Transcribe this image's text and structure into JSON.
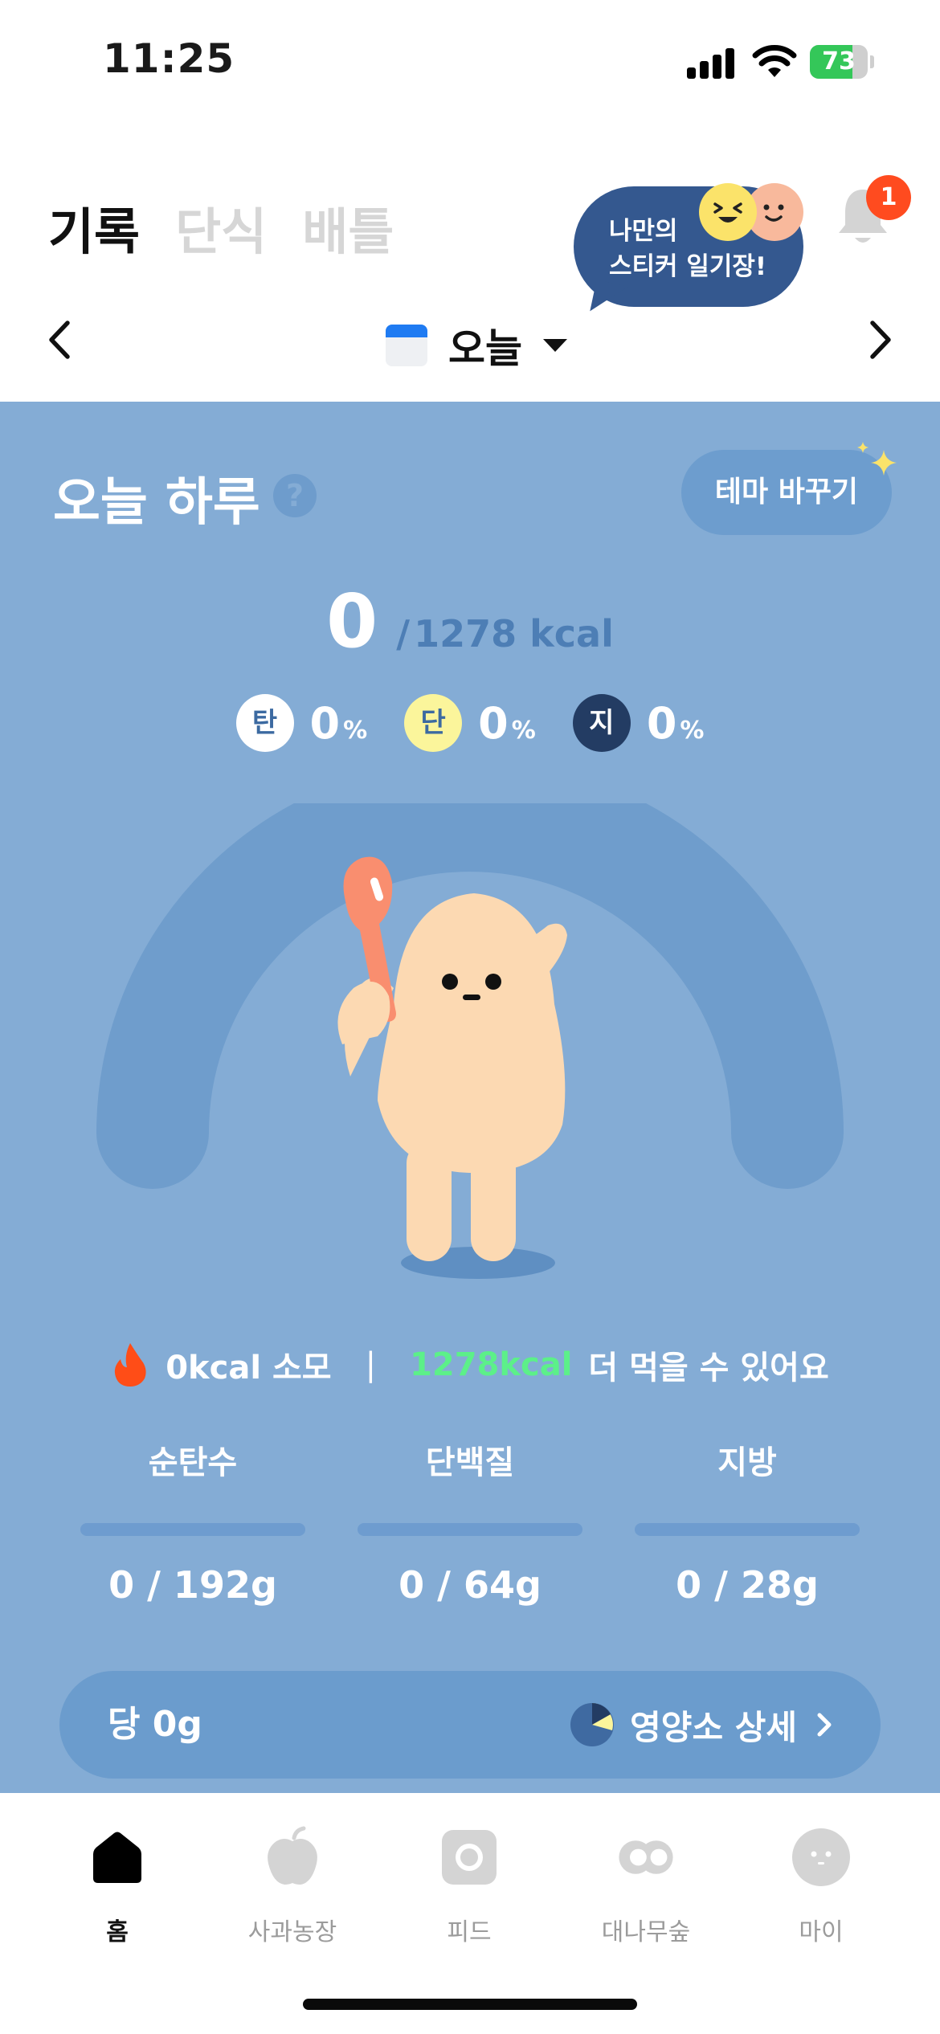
{
  "status_bar": {
    "time": "11:25",
    "battery": "73",
    "battery_level": 0.73,
    "icons": [
      "signal-icon",
      "wifi-icon",
      "battery-charging-icon"
    ]
  },
  "header": {
    "tabs": [
      {
        "label": "기록",
        "active": true
      },
      {
        "label": "단식",
        "active": false
      },
      {
        "label": "배틀",
        "active": false
      }
    ],
    "sticker_promo": {
      "line1": "나만의",
      "line2": "스티커 일기장!"
    },
    "notification_badge": "1",
    "date_label": "오늘"
  },
  "summary": {
    "title": "오늘 하루",
    "help": "?",
    "theme_button": "테마 바꾸기",
    "kcal_current": "0",
    "kcal_separator": "/",
    "kcal_target": "1278 kcal",
    "macros": [
      {
        "chip": "탄",
        "value": "0",
        "unit": "%"
      },
      {
        "chip": "단",
        "value": "0",
        "unit": "%"
      },
      {
        "chip": "지",
        "value": "0",
        "unit": "%"
      }
    ],
    "burn": {
      "burned": "0kcal 소모",
      "divider": "|",
      "remaining": "1278kcal",
      "remaining_suffix": "더 먹을 수 있어요"
    },
    "nutrients": [
      {
        "name": "순탄수",
        "value": "0 / 192g",
        "progress": 0
      },
      {
        "name": "단백질",
        "value": "0 / 64g",
        "progress": 0
      },
      {
        "name": "지방",
        "value": "0 / 28g",
        "progress": 0
      }
    ],
    "sugar": "당 0g",
    "detail_link": "영양소 상세"
  },
  "tab_bar": {
    "items": [
      {
        "label": "홈",
        "icon": "home-icon",
        "active": true
      },
      {
        "label": "사과농장",
        "icon": "apple-icon",
        "active": false
      },
      {
        "label": "피드",
        "icon": "camera-icon",
        "active": false
      },
      {
        "label": "대나무숲",
        "icon": "bamboo-icon",
        "active": false
      },
      {
        "label": "마이",
        "icon": "profile-face-icon",
        "active": false
      }
    ]
  },
  "colors": {
    "card_background": "#84acd5",
    "accent_green": "#5cf089",
    "notification_red": "#ff4b1f",
    "battery_green": "#34c759"
  }
}
